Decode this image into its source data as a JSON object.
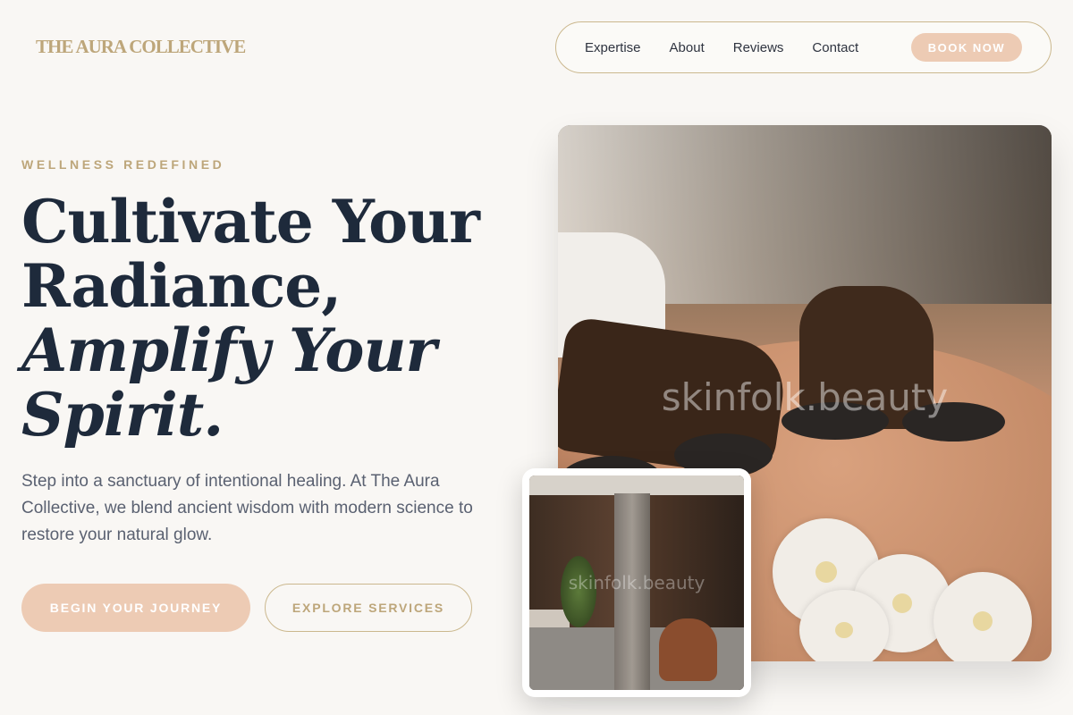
{
  "brand": {
    "logo": "THE AURA COLLECTIVE"
  },
  "nav": {
    "links": [
      "Expertise",
      "About",
      "Reviews",
      "Contact"
    ],
    "cta": "BOOK NOW"
  },
  "hero": {
    "eyebrow": "WELLNESS REDEFINED",
    "headline_line1": "Cultivate Your",
    "headline_line2": "Radiance,",
    "headline_line3": "Amplify Your",
    "headline_line4": "Spirit.",
    "lead": "Step into a sanctuary of intentional healing. At The Aura Collective, we blend ancient wisdom with modern science to restore your natural glow.",
    "primary_cta": "BEGIN YOUR JOURNEY",
    "secondary_cta": "EXPLORE SERVICES"
  },
  "images": {
    "main_watermark": "skinfolk.beauty",
    "secondary_watermark": "skinfolk.beauty"
  },
  "colors": {
    "background": "#f9f7f4",
    "gold": "#bda67a",
    "peach": "#edcbb4",
    "navy": "#1e2a3b"
  }
}
